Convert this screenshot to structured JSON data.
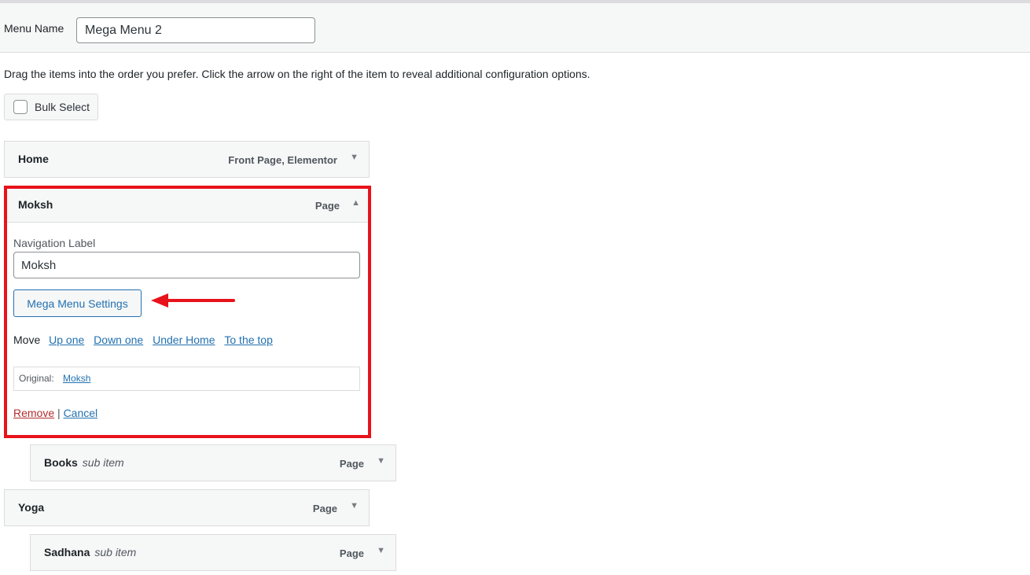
{
  "header": {
    "menu_name_label": "Menu Name",
    "menu_name_value": "Mega Menu 2"
  },
  "instructions": "Drag the items into the order you prefer. Click the arrow on the right of the item to reveal additional configuration options.",
  "bulk_select": {
    "label": "Bulk Select",
    "checked": false
  },
  "menu_items": {
    "home": {
      "title": "Home",
      "type": "Front Page, Elementor"
    },
    "moksh": {
      "title": "Moksh",
      "type": "Page",
      "navigation_label_title": "Navigation Label",
      "navigation_label_value": "Moksh",
      "mega_menu_button": "Mega Menu Settings",
      "move_label": "Move",
      "move_links": [
        "Up one",
        "Down one",
        "Under Home",
        "To the top"
      ],
      "original_label": "Original:",
      "original_link": "Moksh",
      "remove_label": "Remove",
      "separator": "|",
      "cancel_label": "Cancel"
    },
    "books": {
      "title": "Books",
      "subtitle": "sub item",
      "type": "Page"
    },
    "yoga": {
      "title": "Yoga",
      "type": "Page"
    },
    "sadhana": {
      "title": "Sadhana",
      "subtitle": "sub item",
      "type": "Page"
    }
  },
  "icons": {
    "collapsed_arrow": "▼",
    "expanded_arrow": "▲"
  },
  "colors": {
    "highlight_border": "#e8121a",
    "link": "#2271b1",
    "remove_link": "#b32d2e"
  }
}
